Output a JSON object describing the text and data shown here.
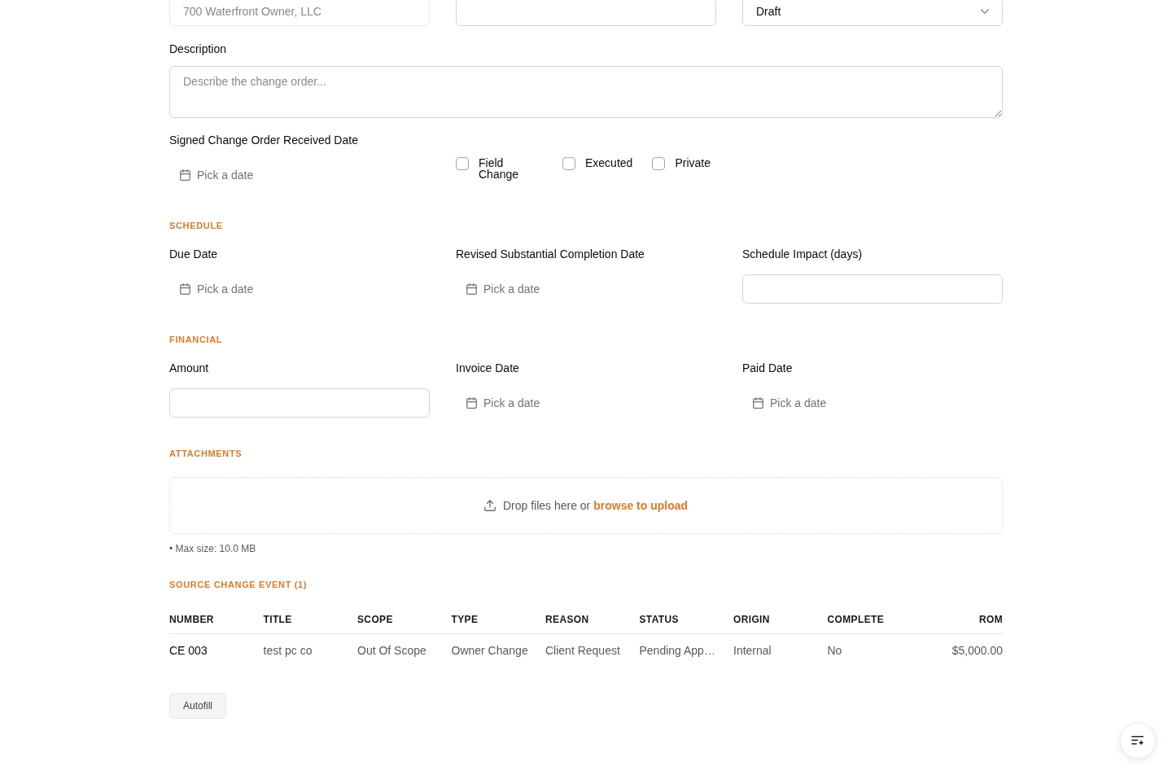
{
  "top_fields": [
    {
      "kind": "input",
      "value": "700 Waterfront Owner, LLC",
      "disabled": true
    },
    {
      "kind": "input",
      "disabled": false
    },
    {
      "kind": "select",
      "value": "Draft",
      "disabled": false
    }
  ],
  "description": {
    "label": "Description",
    "placeholder": "Describe the change order..."
  },
  "signed_date": {
    "kind": "date",
    "label": "Signed Change Order Received Date",
    "placeholder": "Pick a date"
  },
  "flags": [
    {
      "label": "Field Change",
      "checked": false
    },
    {
      "label": "Executed",
      "checked": false
    },
    {
      "label": "Private",
      "checked": false
    }
  ],
  "sections": [
    {
      "title": "SCHEDULE",
      "fields": [
        {
          "kind": "date",
          "label": "Due Date",
          "placeholder": "Pick a date"
        },
        {
          "kind": "date",
          "label": "Revised Substantial Completion Date",
          "placeholder": "Pick a date"
        },
        {
          "kind": "input",
          "label": "Schedule Impact (days)"
        }
      ]
    },
    {
      "title": "FINANCIAL",
      "fields": [
        {
          "kind": "input",
          "label": "Amount"
        },
        {
          "kind": "date",
          "label": "Invoice Date",
          "placeholder": "Pick a date"
        },
        {
          "kind": "date",
          "label": "Paid Date",
          "placeholder": "Pick a date"
        }
      ]
    }
  ],
  "attachments": {
    "title": "ATTACHMENTS",
    "drop_text": "Drop files here or",
    "link_text": "browse to upload",
    "note": "• Max size: 10.0 MB"
  },
  "source_change_event": {
    "title": "SOURCE CHANGE EVENT (1)",
    "columns": [
      "NUMBER",
      "TITLE",
      "SCOPE",
      "TYPE",
      "REASON",
      "STATUS",
      "ORIGIN",
      "COMPLETE",
      "ROM"
    ],
    "rows": [
      [
        "CE 003",
        "test pc co",
        "Out Of Scope",
        "Owner Change",
        "Client Request",
        "Pending App…",
        "Internal",
        "No",
        "$5,000.00"
      ]
    ]
  },
  "autofill_button": "Autofill"
}
